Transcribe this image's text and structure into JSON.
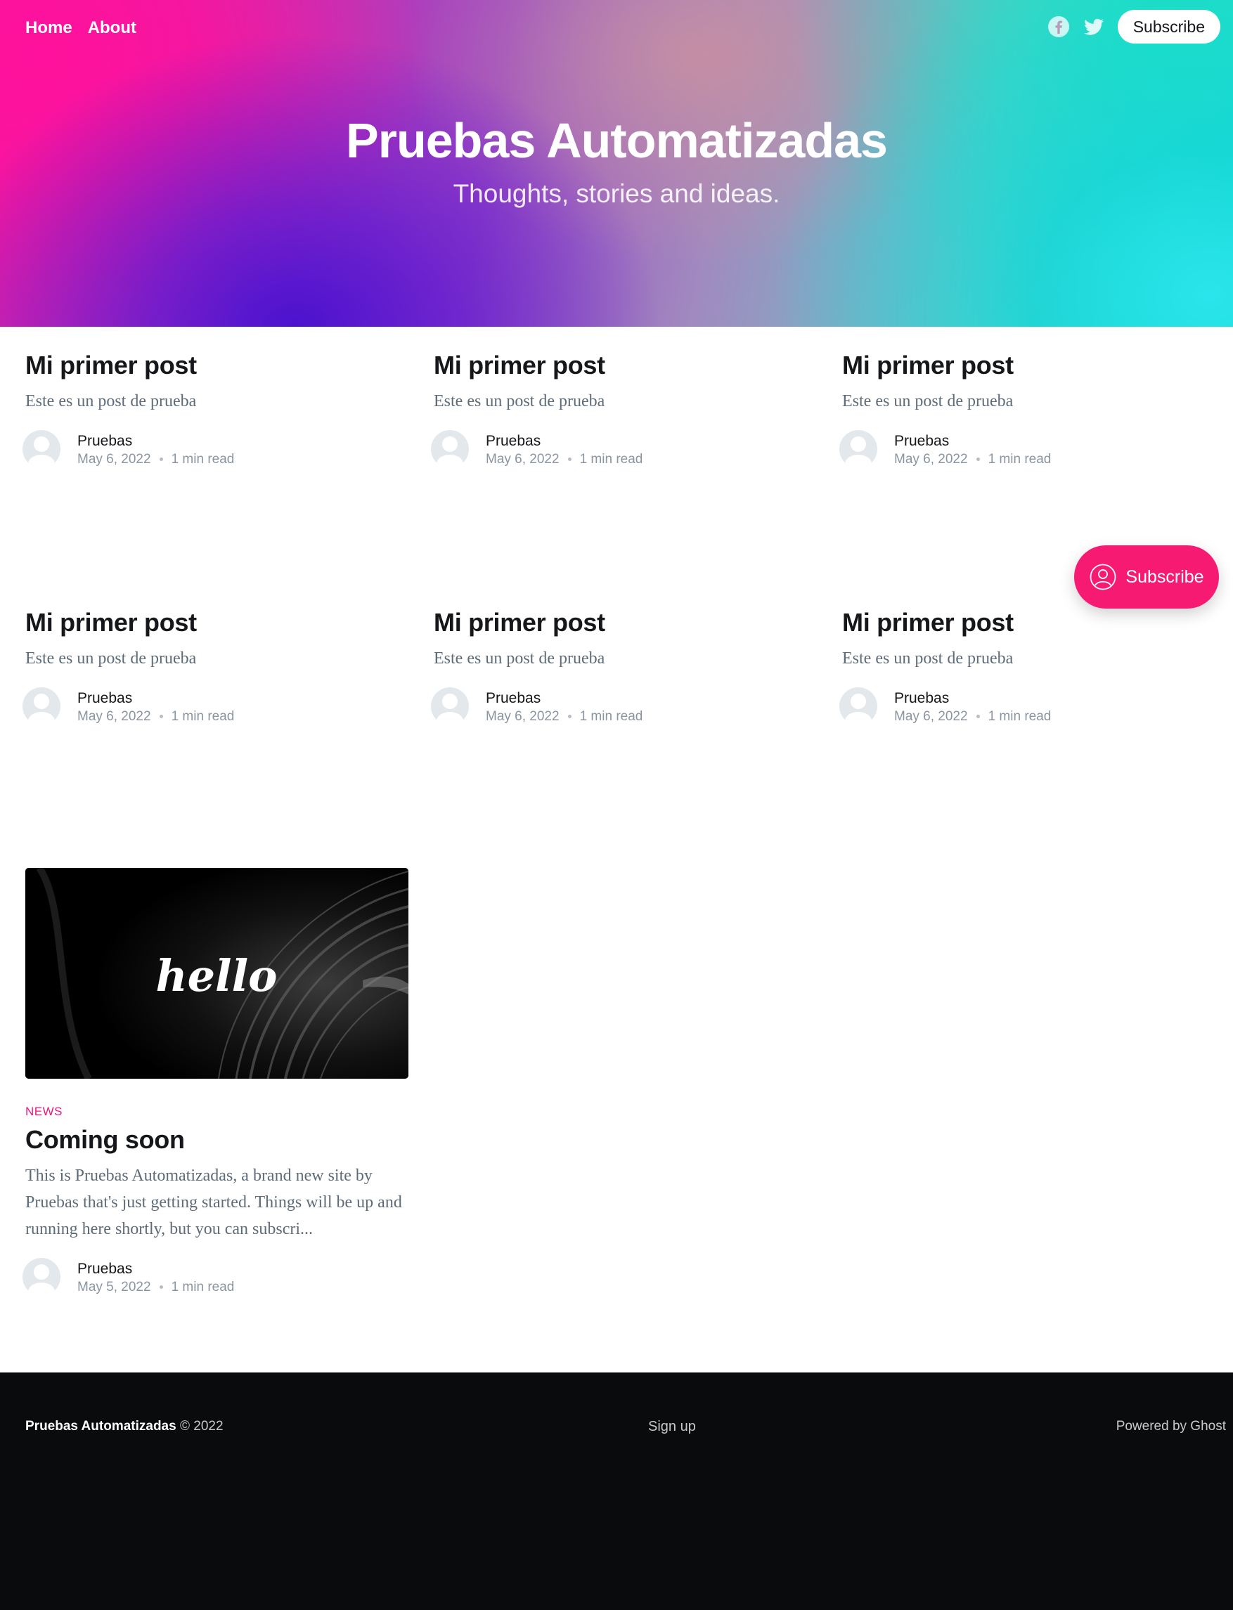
{
  "nav": {
    "links": [
      "Home",
      "About"
    ],
    "subscribe_label": "Subscribe"
  },
  "hero": {
    "title": "Pruebas Automatizadas",
    "subtitle": "Thoughts, stories and ideas."
  },
  "posts": [
    {
      "title": "Mi primer post",
      "excerpt": "Este es un post de prueba",
      "author": "Pruebas",
      "date": "May 6, 2022",
      "read_time": "1 min read"
    },
    {
      "title": "Mi primer post",
      "excerpt": "Este es un post de prueba",
      "author": "Pruebas",
      "date": "May 6, 2022",
      "read_time": "1 min read"
    },
    {
      "title": "Mi primer post",
      "excerpt": "Este es un post de prueba",
      "author": "Pruebas",
      "date": "May 6, 2022",
      "read_time": "1 min read"
    },
    {
      "title": "Mi primer post",
      "excerpt": "Este es un post de prueba",
      "author": "Pruebas",
      "date": "May 6, 2022",
      "read_time": "1 min read"
    },
    {
      "title": "Mi primer post",
      "excerpt": "Este es un post de prueba",
      "author": "Pruebas",
      "date": "May 6, 2022",
      "read_time": "1 min read"
    },
    {
      "title": "Mi primer post",
      "excerpt": "Este es un post de prueba",
      "author": "Pruebas",
      "date": "May 6, 2022",
      "read_time": "1 min read"
    }
  ],
  "featured": {
    "image_text": "hello",
    "tag": "NEWS",
    "title": "Coming soon",
    "excerpt": "This is Pruebas Automatizadas, a brand new site by Pruebas that's just getting started. Things will be up and running here shortly, but you can subscri...",
    "author": "Pruebas",
    "date": "May 5, 2022",
    "read_time": "1 min read"
  },
  "floating_subscribe": {
    "label": "Subscribe"
  },
  "footer": {
    "site_name": "Pruebas Automatizadas",
    "copyright": "© 2022",
    "signup": "Sign up",
    "powered_by": "Powered by Ghost"
  },
  "colors": {
    "accent": "#f71a72",
    "tag": "#f0157f",
    "footer_bg": "#0a0b0d",
    "text_dark": "#15171a"
  },
  "icons": [
    "facebook-icon",
    "twitter-icon",
    "user-circle-icon",
    "avatar-placeholder"
  ]
}
